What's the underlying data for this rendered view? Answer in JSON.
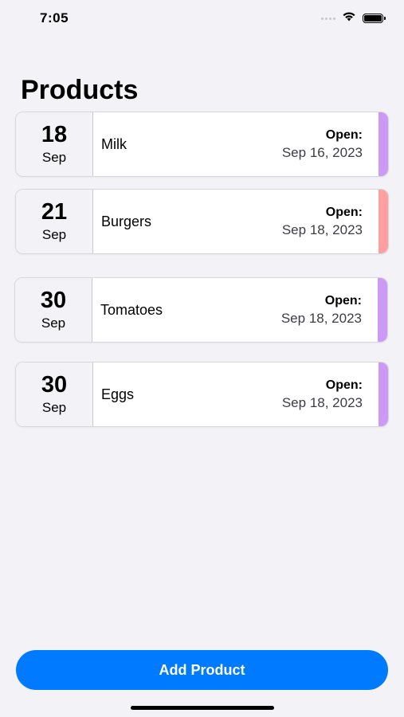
{
  "status_bar": {
    "time": "7:05",
    "icons": [
      "cellular-signal-icon",
      "wifi-icon",
      "battery-icon"
    ]
  },
  "title": "Products",
  "products": [
    {
      "day": "18",
      "month": "Sep",
      "name": "Milk",
      "open_label": "Open:",
      "open_date": "Sep 16, 2023",
      "color": "#cc99f5"
    },
    {
      "day": "21",
      "month": "Sep",
      "name": "Burgers",
      "open_label": "Open:",
      "open_date": "Sep 18, 2023",
      "color": "#ff9f9f"
    },
    {
      "day": "30",
      "month": "Sep",
      "name": "Tomatoes",
      "open_label": "Open:",
      "open_date": "Sep 18, 2023",
      "color": "#cc99f5"
    },
    {
      "day": "30",
      "month": "Sep",
      "name": "Eggs",
      "open_label": "Open:",
      "open_date": "Sep 18, 2023",
      "color": "#cc99f5"
    }
  ],
  "add_button_label": "Add Product",
  "colors": {
    "accent": "#007aff",
    "background": "#f2f2f7"
  }
}
